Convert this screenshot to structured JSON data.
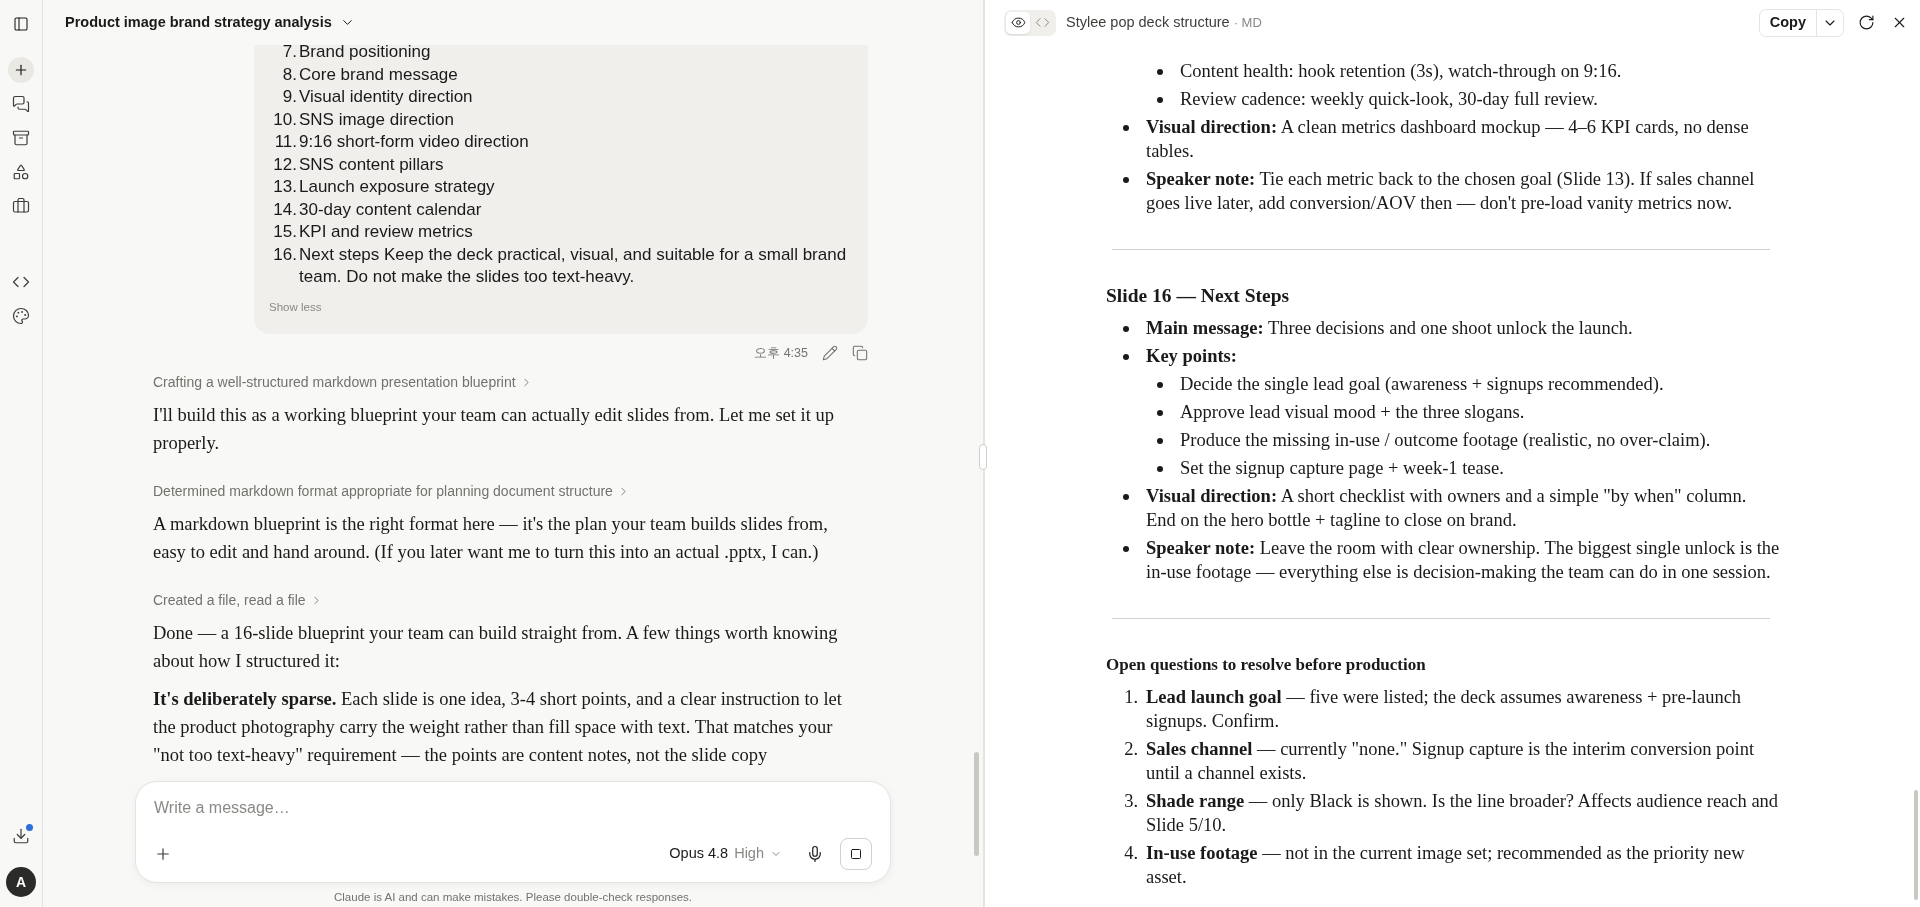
{
  "sidebar": {
    "avatar": "A",
    "download_badge": true
  },
  "chat": {
    "title": "Product image brand strategy analysis",
    "user_message": {
      "items": [
        {
          "number": "7.",
          "text": "Brand positioning"
        },
        {
          "number": "8.",
          "text": "Core brand message"
        },
        {
          "number": "9.",
          "text": "Visual identity direction"
        },
        {
          "number": "10.",
          "text": "SNS image direction"
        },
        {
          "number": "11.",
          "text": "9:16 short-form video direction"
        },
        {
          "number": "12.",
          "text": "SNS content pillars"
        },
        {
          "number": "13.",
          "text": "Launch exposure strategy"
        },
        {
          "number": "14.",
          "text": "30-day content calendar"
        },
        {
          "number": "15.",
          "text": "KPI and review metrics"
        },
        {
          "number": "16.",
          "text": "Next steps Keep the deck practical, visual, and suitable for a small brand team. Do not make the slides too text-heavy."
        }
      ],
      "toggle": "Show less",
      "time": "오후 4:35"
    },
    "blocks": [
      {
        "kind": "thought",
        "text": "Crafting a well-structured markdown presentation blueprint"
      },
      {
        "kind": "paragraph",
        "text": "I'll build this as a working blueprint your team can actually edit slides from. Let me set it up properly."
      },
      {
        "kind": "thought",
        "text": "Determined markdown format appropriate for planning document structure"
      },
      {
        "kind": "paragraph",
        "text": "A markdown blueprint is the right format here — it's the plan your team builds slides from, easy to edit and hand around. (If you later want me to turn this into an actual .pptx, I can.)"
      },
      {
        "kind": "thought",
        "text": "Created a file, read a file"
      },
      {
        "kind": "paragraph",
        "text": "Done — a 16-slide blueprint your team can build straight from. A few things worth knowing about how I structured it:"
      },
      {
        "kind": "paragraph",
        "text": "**It's deliberately sparse.** Each slide is one idea, 3-4 short points, and a clear instruction to let the product photography carry the weight rather than fill space with text. That matches your \"not too text-heavy\" requirement — the points are content notes, not the slide copy"
      }
    ],
    "composer": {
      "placeholder": "Write a message…",
      "model": "Opus 4.8",
      "effort": "High"
    },
    "disclaimer": "Claude is AI and can make mistakes. Please double-check responses."
  },
  "artifact": {
    "title": "Stylee pop deck structure",
    "format": "· MD",
    "views": [
      {
        "kind": "preview",
        "selected": true
      },
      {
        "kind": "code",
        "selected": false
      }
    ],
    "copy": "Copy",
    "content": [
      {
        "kind": "bullets",
        "items": [
          {
            "children": [
              {
                "text": "Content health: hook retention (3s), watch-through on 9:16."
              },
              {
                "text": "Review cadence: weekly quick-look, 30-day full review."
              }
            ]
          },
          {
            "text": "**Visual direction:** A clean metrics dashboard mockup — 4–6 KPI cards, no dense tables."
          },
          {
            "text": "**Speaker note:** Tie each metric back to the chosen goal (Slide 13). If sales channel goes live later, add conversion/AOV then — don't pre-load vanity metrics now."
          }
        ]
      },
      {
        "kind": "rule"
      },
      {
        "kind": "heading",
        "text": "Slide 16 — Next Steps"
      },
      {
        "kind": "bullets",
        "items": [
          {
            "text": "**Main message:** Three decisions and one shoot unlock the launch."
          },
          {
            "text": "**Key points:**",
            "children": [
              {
                "text": "Decide the single lead goal (awareness + signups recommended)."
              },
              {
                "text": "Approve lead visual mood + the three slogans."
              },
              {
                "text": "Produce the missing in-use / outcome footage (realistic, no over-claim)."
              },
              {
                "text": "Set the signup capture page + week-1 tease."
              }
            ]
          },
          {
            "text": "**Visual direction:** A short checklist with owners and a simple \"by when\" column. End on the hero bottle + tagline to close on brand."
          },
          {
            "text": "**Speaker note:** Leave the room with clear ownership. The biggest single unlock is the in-use footage — everything else is decision-making the team can do in one session."
          }
        ]
      },
      {
        "kind": "rule"
      },
      {
        "kind": "subheading",
        "text": "Open questions to resolve before production"
      },
      {
        "kind": "ordered",
        "items": [
          {
            "number": "1.",
            "text": "**Lead launch goal** — five were listed; the deck assumes awareness + pre-launch signups. Confirm."
          },
          {
            "number": "2.",
            "text": "**Sales channel** — currently \"none.\" Signup capture is the interim conversion point until a channel exists."
          },
          {
            "number": "3.",
            "text": "**Shade range** — only Black is shown. Is the line broader? Affects audience reach and Slide 5/10."
          },
          {
            "number": "4.",
            "text": "**In-use footage** — not in the current image set; recommended as the priority new asset."
          }
        ]
      }
    ]
  }
}
